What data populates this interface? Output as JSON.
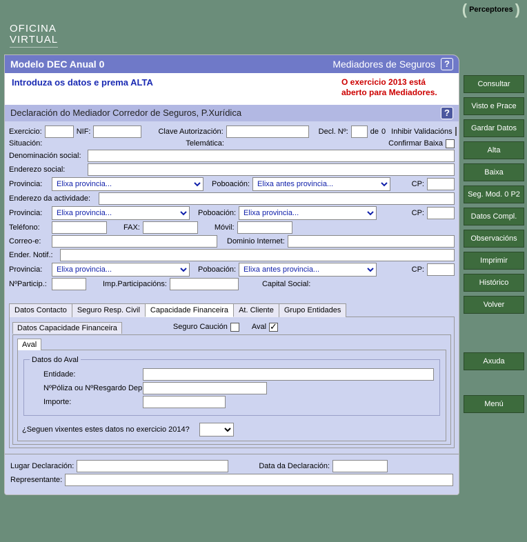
{
  "brand": {
    "line1": "OFICINA",
    "line2": "VIRTUAL"
  },
  "top_tab": "Perceptores",
  "header": {
    "title_left": "Modelo DEC Anual 0",
    "title_right": "Mediadores de Seguros"
  },
  "intro": {
    "left": "Introduza os datos e prema ALTA",
    "right": "O exercicio 2013 está aberto para Mediadores."
  },
  "section_title": "Declaración do Mediador Corredor de Seguros, P.Xurídica",
  "form": {
    "exercicio_lbl": "Exercicio:",
    "nif_lbl": "NIF:",
    "clave_aut_lbl": "Clave Autorización:",
    "decl_num_lbl": "Decl. Nº:",
    "de_lbl": "de",
    "de_val": "0",
    "inhib_lbl": "Inhibir Validacións",
    "situacion_lbl": "Situación:",
    "telematica_lbl": "Telemática:",
    "conf_baixa_lbl": "Confirmar Baixa",
    "denom_lbl": "Denominación social:",
    "ender_social_lbl": "Enderezo social:",
    "provincia_lbl": "Provincia:",
    "poboacion_lbl": "Poboación:",
    "cp_lbl": "CP:",
    "ender_act_lbl": "Enderezo da actividade:",
    "telefono_lbl": "Teléfono:",
    "fax_lbl": "FAX:",
    "movil_lbl": "Móvil:",
    "correo_lbl": "Correo-e:",
    "dom_int_lbl": "Dominio Internet:",
    "ender_notif_lbl": "Ender. Notif.:",
    "nparticip_lbl": "NºParticip.:",
    "imp_part_lbl": "Imp.Participacións:",
    "capital_lbl": "Capital Social:",
    "prov_placeholder": "Elixa provincia...",
    "pob_antes_placeholder": "Elixa antes provincia...",
    "pob_prov_placeholder": "Elixa provincia..."
  },
  "tabs": {
    "contacto": "Datos Contacto",
    "seguro": "Seguro Resp. Civil",
    "capacidade": "Capacidade Financeira",
    "atcliente": "At. Cliente",
    "grupo": "Grupo Entidades"
  },
  "cap_fin": {
    "panel_title": "Datos Capacidade Financeira",
    "seguro_caucion_lbl": "Seguro Caución",
    "aval_lbl": "Aval",
    "aval_tab": "Aval",
    "fieldset_legend": "Datos do Aval",
    "entidade_lbl": "Entidade:",
    "poliza_lbl": "NºPóliza ou NºResgardo Dep.:",
    "importe_lbl": "Importe:",
    "vixentes_q": "¿Seguen vixentes estes datos no exercicio 2014?"
  },
  "footer": {
    "lugar_lbl": "Lugar Declaración:",
    "data_lbl": "Data da Declaración:",
    "repr_lbl": "Representante:"
  },
  "sidebar": {
    "consultar": "Consultar",
    "visto": "Visto e Prace",
    "gardar": "Gardar Datos",
    "alta": "Alta",
    "baixa": "Baixa",
    "segmod": "Seg. Mod. 0 P2",
    "datoscompl": "Datos Compl.",
    "observ": "Observacións",
    "imprimir": "Imprimir",
    "historico": "Histórico",
    "volver": "Volver",
    "axuda": "Axuda",
    "menu": "Menú"
  }
}
